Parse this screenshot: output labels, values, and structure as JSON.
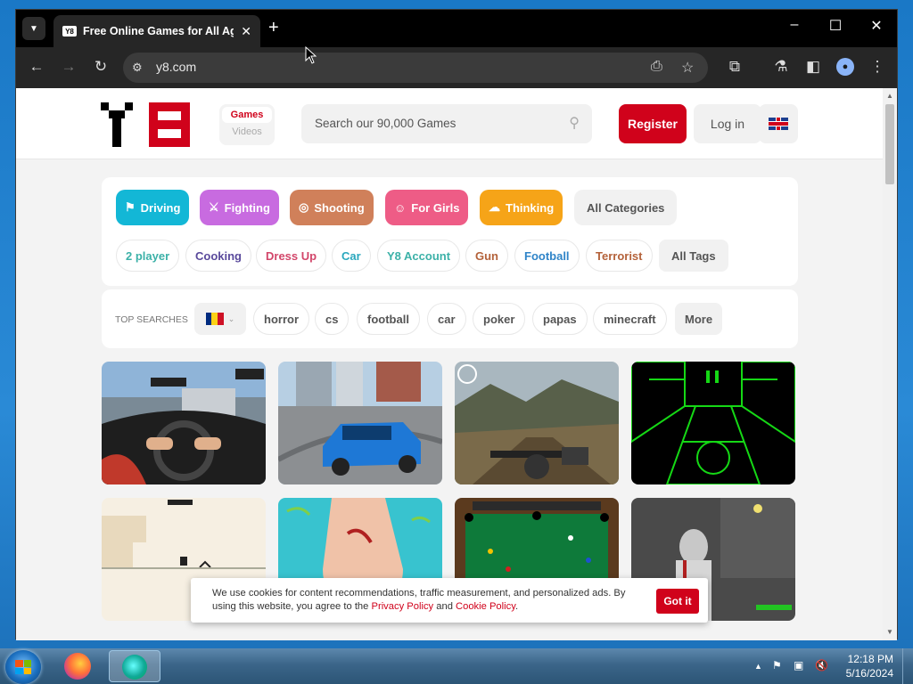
{
  "browser": {
    "tab_title": "Free Online Games for All Ag",
    "tab_favicon": "Y8",
    "url": "y8.com"
  },
  "header": {
    "games_label": "Games",
    "videos_label": "Videos",
    "search_placeholder": "Search our 90,000 Games",
    "register_label": "Register",
    "login_label": "Log in"
  },
  "categories": [
    {
      "label": "Driving",
      "color": "#13b7d6",
      "icon": "checkered-flag-icon"
    },
    {
      "label": "Fighting",
      "color": "#c86be0",
      "icon": "crossed-swords-icon"
    },
    {
      "label": "Shooting",
      "color": "#d0805a",
      "icon": "target-icon"
    },
    {
      "label": "For Girls",
      "color": "#ee5c86",
      "icon": "girl-face-icon"
    },
    {
      "label": "Thinking",
      "color": "#f6a418",
      "icon": "brain-icon"
    }
  ],
  "all_categories_label": "All Categories",
  "tags": [
    {
      "label": "2 player",
      "color": "#3cb1a8"
    },
    {
      "label": "Cooking",
      "color": "#5a4a9c"
    },
    {
      "label": "Dress Up",
      "color": "#d2466a"
    },
    {
      "label": "Car",
      "color": "#2aa7bd"
    },
    {
      "label": "Y8 Account",
      "color": "#3cb1a8"
    },
    {
      "label": "Gun",
      "color": "#b4623a"
    },
    {
      "label": "Football",
      "color": "#2f84c8"
    },
    {
      "label": "Terrorist",
      "color": "#b4623a"
    }
  ],
  "all_tags_label": "All Tags",
  "top_searches": {
    "label": "TOP SEARCHES",
    "country": "Romania",
    "terms": [
      "horror",
      "cs",
      "football",
      "car",
      "poker",
      "papas",
      "minecraft"
    ],
    "more_label": "More"
  },
  "cookie": {
    "text_1": "We use cookies for content recommendations, traffic measurement, and personalized ads. By using this website, you agree to the",
    "privacy_link": "Privacy Policy",
    "and": "and",
    "cookie_link": "Cookie Policy",
    "period": ".",
    "button": "Got it"
  },
  "taskbar": {
    "time": "12:18 PM",
    "date": "5/16/2024"
  }
}
